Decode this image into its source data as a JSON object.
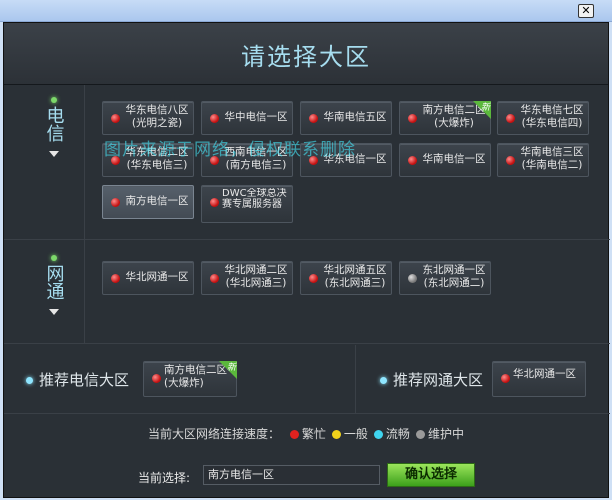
{
  "window": {
    "close_glyph": "✕"
  },
  "page_title": "请选择大区",
  "watermark": "图片来源于网络，侵权联系删除",
  "telecom": {
    "label": "电信",
    "servers": [
      {
        "name": "华东电信八区",
        "sub": "(光明之瓷)",
        "status": "busy"
      },
      {
        "name": "华中电信一区",
        "sub": "",
        "status": "busy"
      },
      {
        "name": "华南电信五区",
        "sub": "",
        "status": "busy"
      },
      {
        "name": "南方电信二区",
        "sub": "(大爆炸)",
        "status": "busy",
        "badge": "新"
      },
      {
        "name": "华东电信七区",
        "sub": "(华东电信四)",
        "status": "busy"
      },
      {
        "name": "华东电信二区",
        "sub": "(华东电信三)",
        "status": "busy"
      },
      {
        "name": "西南电信一区",
        "sub": "(南方电信三)",
        "status": "busy"
      },
      {
        "name": "华东电信一区",
        "sub": "",
        "status": "busy"
      },
      {
        "name": "华南电信一区",
        "sub": "",
        "status": "busy"
      },
      {
        "name": "华南电信三区",
        "sub": "(华南电信二)",
        "status": "busy"
      },
      {
        "name": "南方电信一区",
        "sub": "",
        "status": "busy",
        "selected": true
      },
      {
        "name": "DWC全球总决赛专属服务器",
        "sub": "",
        "status": "busy"
      }
    ]
  },
  "netcom": {
    "label": "网通",
    "servers": [
      {
        "name": "华北网通一区",
        "sub": "",
        "status": "busy"
      },
      {
        "name": "华北网通二区",
        "sub": "(华北网通三)",
        "status": "busy"
      },
      {
        "name": "华北网通五区",
        "sub": "(东北网通三)",
        "status": "busy"
      },
      {
        "name": "东北网通一区",
        "sub": "(东北网通二)",
        "status": "maintenance"
      }
    ]
  },
  "recommend": {
    "telecom_label": "推荐电信大区",
    "telecom_server": {
      "name": "南方电信二区",
      "sub": "(大爆炸)",
      "badge": "新"
    },
    "netcom_label": "推荐网通大区",
    "netcom_server": {
      "name": "华北网通一区",
      "sub": ""
    }
  },
  "legend": {
    "prefix": "当前大区网络连接速度：",
    "items": [
      {
        "label": "繁忙",
        "color": "#e0221f"
      },
      {
        "label": "一般",
        "color": "#f0d21b"
      },
      {
        "label": "流畅",
        "color": "#3fd4ef"
      },
      {
        "label": "维护中",
        "color": "#9a9a9a"
      }
    ]
  },
  "current": {
    "label": "当前选择:",
    "value": "南方电信一区"
  },
  "confirm_label": "确认选择"
}
